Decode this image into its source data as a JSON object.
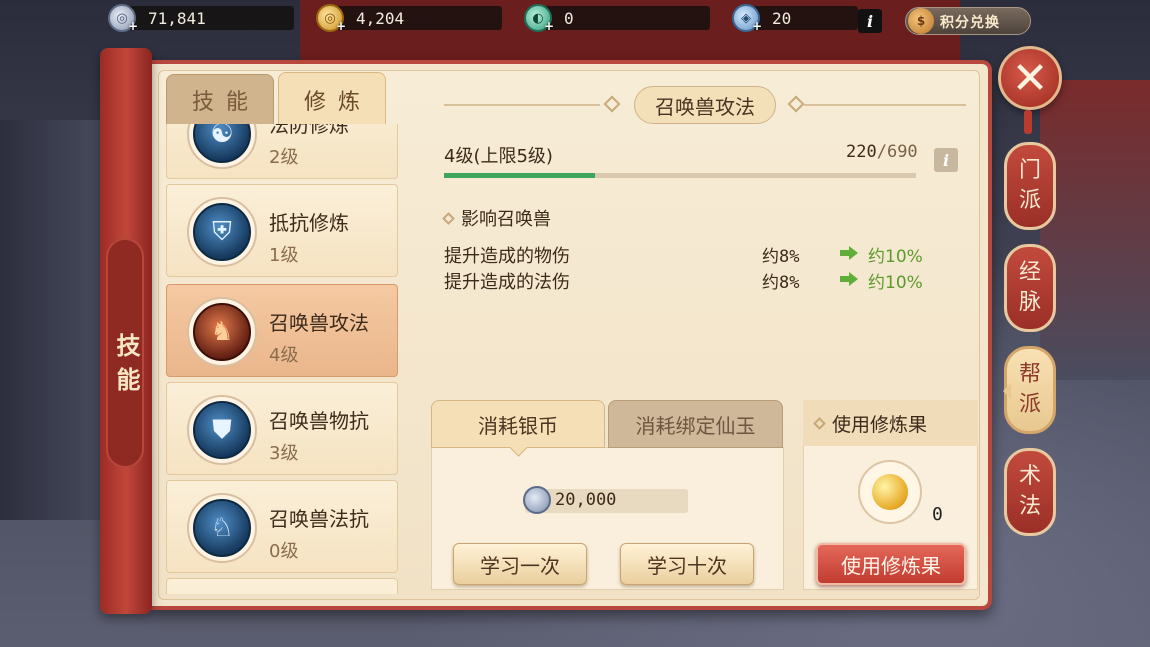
{
  "currency": {
    "silver": "71,841",
    "gold": "4,204",
    "jade": "0",
    "bound_jade": "20",
    "exchange_label": "积分兑换"
  },
  "tabs": {
    "skill": "技能",
    "train": "修炼"
  },
  "side_title": "技能",
  "list": [
    {
      "name": "法防修炼",
      "level": "2级"
    },
    {
      "name": "抵抗修炼",
      "level": "1级"
    },
    {
      "name": "召唤兽攻法",
      "level": "4级",
      "selected": true
    },
    {
      "name": "召唤兽物抗",
      "level": "3级"
    },
    {
      "name": "召唤兽法抗",
      "level": "0级"
    }
  ],
  "right_tabs": [
    {
      "label_top": "门",
      "label_bottom": "派"
    },
    {
      "label_top": "经",
      "label_bottom": "脉"
    },
    {
      "label_top": "帮",
      "label_bottom": "派",
      "active": true
    },
    {
      "label_top": "术",
      "label_bottom": "法"
    }
  ],
  "detail": {
    "title": "召唤兽攻法",
    "level_text": "4级(上限5级)",
    "exp_current": "220",
    "exp_total": "/690",
    "exp_progress": 0.319,
    "effect_head": "影响召唤兽",
    "effects": [
      {
        "label": "提升造成的物伤",
        "current": "约8%",
        "next": "约10%"
      },
      {
        "label": "提升造成的法伤",
        "current": "约8%",
        "next": "约10%"
      }
    ]
  },
  "cost": {
    "tab_silver": "消耗银币",
    "tab_jade": "消耗绑定仙玉",
    "amount": "20,000",
    "learn_once": "学习一次",
    "learn_ten": "学习十次"
  },
  "fruit": {
    "head": "使用修炼果",
    "count": "0",
    "use_button": "使用修炼果"
  },
  "colors": {
    "panel_red": "#b8473d",
    "parchment": "#f3e6cd",
    "progress_green": "#3fa55c",
    "next_value_green": "#5d9a2c"
  }
}
